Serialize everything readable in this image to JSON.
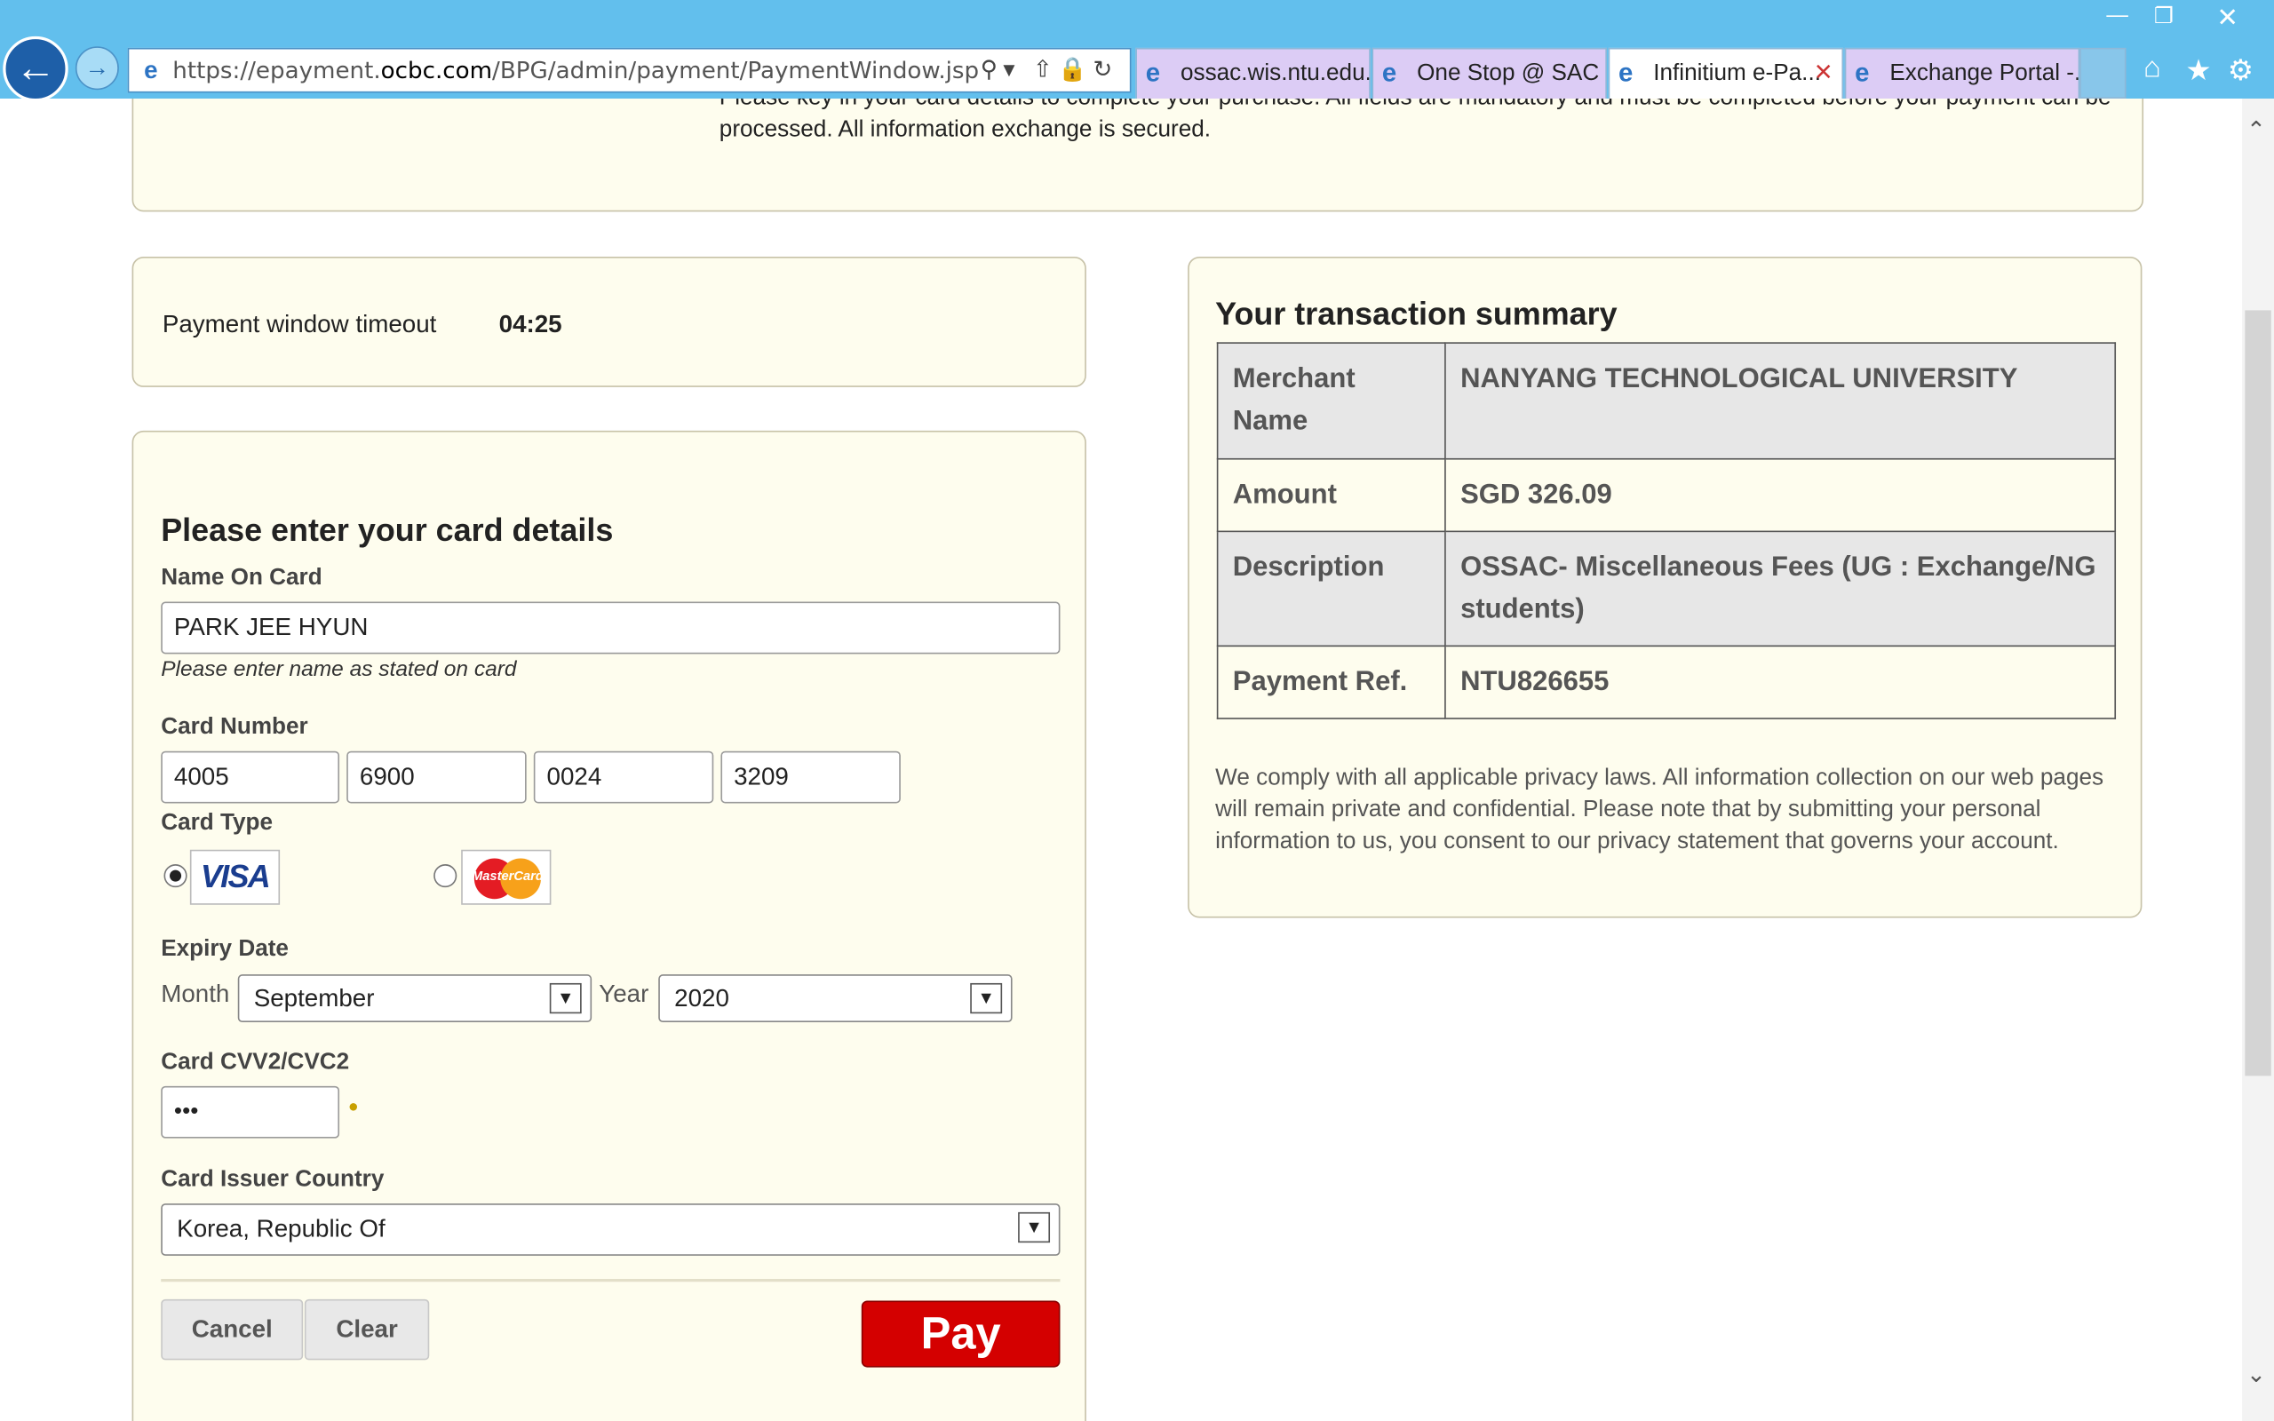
{
  "browser": {
    "url_prefix": "https://epayment.",
    "url_domain": "ocbc.com",
    "url_path": "/BPG/admin/payment/PaymentWindow.jsp",
    "tabs": [
      {
        "label": "ossac.wis.ntu.edu...."
      },
      {
        "label": "One Stop @ SAC"
      },
      {
        "label": "Infinitium e-Pa..."
      },
      {
        "label": "Exchange Portal -..."
      }
    ],
    "active_tab_index": 2
  },
  "intro": {
    "message": "Please key in your card details to complete your purchase. All fields are mandatory and must be completed before your payment can be processed. All information exchange is secured."
  },
  "timeout": {
    "label": "Payment window timeout",
    "value": "04:25"
  },
  "card_form": {
    "heading": "Please enter your card details",
    "name_label": "Name On Card",
    "name_value": "PARK JEE HYUN",
    "name_hint": "Please enter name as stated on card",
    "number_label": "Card Number",
    "number_parts": [
      "4005",
      "6900",
      "0024",
      "3209"
    ],
    "type_label": "Card Type",
    "card_types": [
      {
        "name": "VISA",
        "selected": true
      },
      {
        "name": "MasterCard",
        "selected": false
      }
    ],
    "expiry_label": "Expiry Date",
    "month_label": "Month",
    "month_value": "September",
    "year_label": "Year",
    "year_value": "2020",
    "cvv_label": "Card CVV2/CVC2",
    "cvv_value": "•••",
    "country_label": "Card Issuer Country",
    "country_value": "Korea, Republic Of",
    "cancel_label": "Cancel",
    "clear_label": "Clear",
    "pay_label": "Pay"
  },
  "summary": {
    "heading": "Your transaction summary",
    "rows": [
      {
        "key": "Merchant Name",
        "value": "NANYANG TECHNOLOGICAL UNIVERSITY"
      },
      {
        "key": "Amount",
        "value": "SGD 326.09"
      },
      {
        "key": "Description",
        "value": "OSSAC- Miscellaneous Fees (UG : Exchange/NG students)"
      },
      {
        "key": "Payment Ref.",
        "value": "NTU826655"
      }
    ],
    "privacy": "We comply with all applicable privacy laws. All information collection on our web pages will remain private and confidential. Please note that by submitting your personal information to us, you consent to our privacy statement that governs your account."
  },
  "colors": {
    "chrome": "#62bfed",
    "panel_bg": "#fefdee",
    "pay_button": "#d40000"
  }
}
